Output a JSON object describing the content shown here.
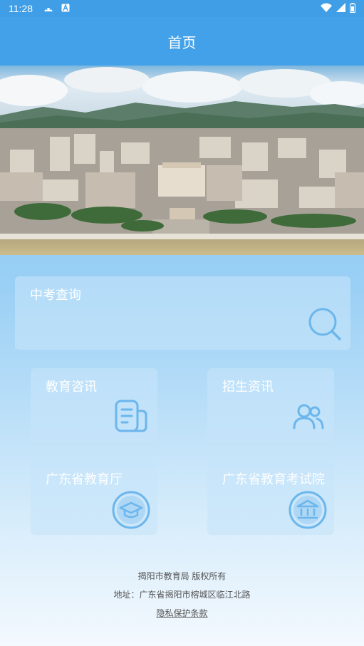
{
  "status_bar": {
    "time": "11:28"
  },
  "app_bar": {
    "title": "首页"
  },
  "query_card": {
    "label": "中考查询",
    "icon": "search-icon"
  },
  "grid_cards": [
    {
      "label": "教育咨讯",
      "icon": "document-icon"
    },
    {
      "label": "招生资讯",
      "icon": "users-icon"
    },
    {
      "label": "广东省教育厅",
      "icon": "graduation-cap-icon"
    },
    {
      "label": "广东省教育考试院",
      "icon": "institution-icon"
    }
  ],
  "footer": {
    "copyright": "揭阳市教育局 版权所有",
    "address": "地址：广东省揭阳市榕城区临江北路",
    "privacy_link": "隐私保护条款"
  },
  "colors": {
    "app_bar": "#42a1e8",
    "card_bg": "#c6e4fa",
    "icon": "#6bb6ec"
  }
}
